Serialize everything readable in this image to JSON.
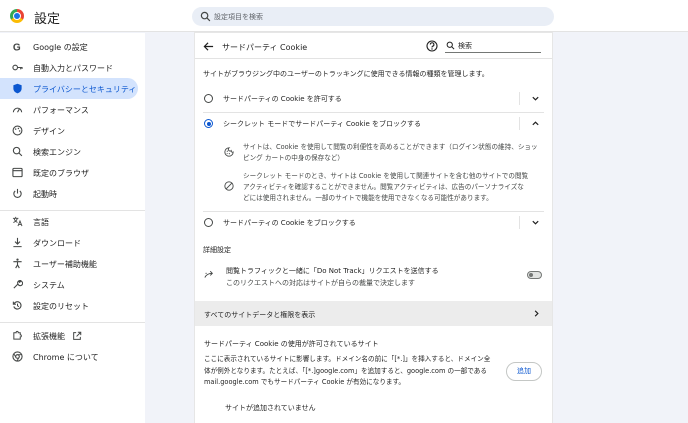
{
  "app": {
    "title": "設定"
  },
  "search": {
    "placeholder": "設定項目を検索"
  },
  "sidebar": {
    "items": [
      {
        "label": "Google の設定"
      },
      {
        "label": "自動入力とパスワード"
      },
      {
        "label": "プライバシーとセキュリティ"
      },
      {
        "label": "パフォーマンス"
      },
      {
        "label": "デザイン"
      },
      {
        "label": "検索エンジン"
      },
      {
        "label": "既定のブラウザ"
      },
      {
        "label": "起動時"
      },
      {
        "label": "言語"
      },
      {
        "label": "ダウンロード"
      },
      {
        "label": "ユーザー補助機能"
      },
      {
        "label": "システム"
      },
      {
        "label": "設定のリセット"
      },
      {
        "label": "拡張機能"
      },
      {
        "label": "Chrome について"
      }
    ]
  },
  "page": {
    "title": "サードパーティ Cookie",
    "search_value": "検索",
    "description": "サイトがブラウジング中のユーザーのトラッキングに使用できる情報の種類を管理します。",
    "options": [
      {
        "label": "サードパーティの Cookie を許可する"
      },
      {
        "label": "シークレット モードでサードパーティ Cookie をブロックする"
      },
      {
        "label": "サードパーティの Cookie をブロックする"
      }
    ],
    "detail1": [
      "サイトは、Cookie を使用して閲覧の利便性を高めることができます（ログイン状態の維持、ショッ",
      "ピング カートの中身の保存など）"
    ],
    "detail2": [
      "シークレット モードのとき、サイトは Cookie を使用して関連サイトを含む他のサイトでの閲覧",
      "アクティビティを確認することができません。閲覧アクティビティは、広告のパーソナライズな",
      "どには使用されません。一部のサイトで機能を使用できなくなる可能性があります。"
    ],
    "advanced_heading": "詳細設定",
    "dnt_title": "閲覧トラフィックと一緒に「Do Not Track」リクエストを送信する",
    "dnt_subtitle": "このリクエストへの対応はサイトが自らの裁量で決定します",
    "all_site_data": "すべてのサイトデータと権限を表示",
    "allowed_heading": "サードパーティ Cookie の使用が許可されているサイト",
    "allowed_desc": [
      "ここに表示されているサイトに影響します。ドメイン名の前に「[*.]」を挿入すると、ドメイン全",
      "体が例外となります。たとえば、「[*.]google.com」を追加すると、google.com の一部である",
      "mail.google.com でもサードパーティ Cookie が有効になります。"
    ],
    "add_label": "追加",
    "empty_text": "サイトが追加されていません"
  },
  "colors": {
    "accent": "#0b57d0",
    "active_bg": "#d3e3fd"
  }
}
